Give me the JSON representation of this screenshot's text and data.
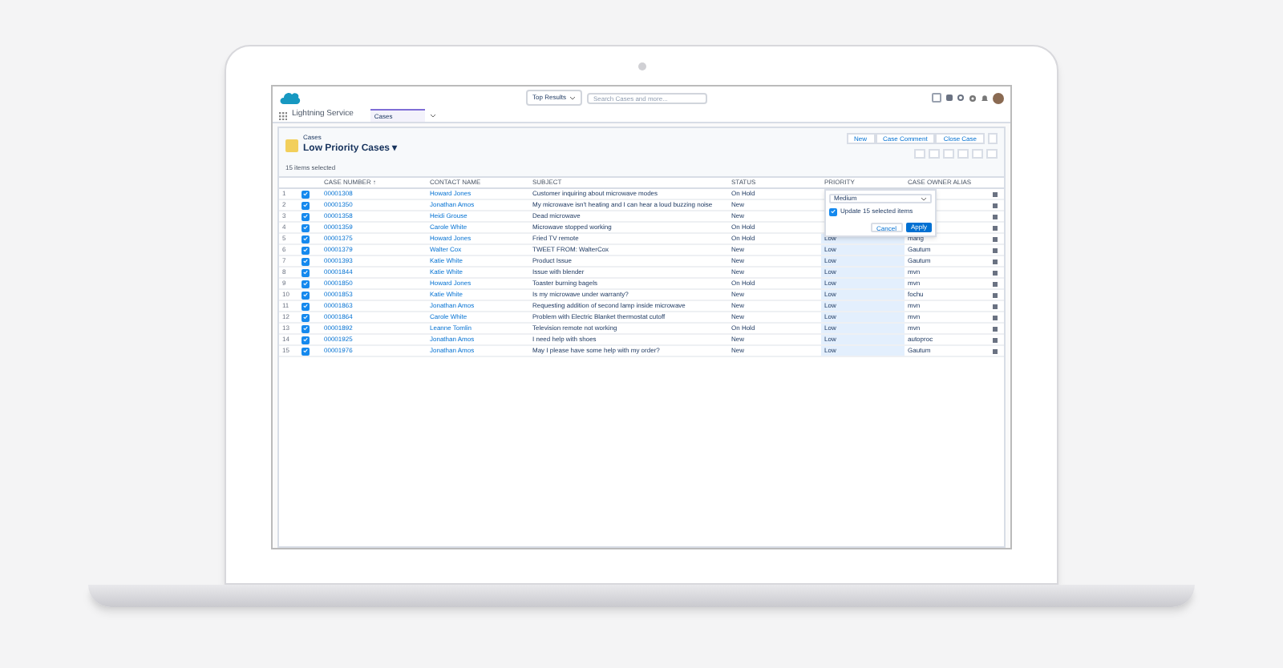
{
  "header": {
    "scope": "Top Results",
    "search": {
      "placeholder": "Search Cases and more..."
    }
  },
  "nav": {
    "app_name": "Lightning Service",
    "tabs": [
      {
        "label": "Cases",
        "selected": true
      }
    ]
  },
  "list": {
    "object": "Cases",
    "title": "Low Priority Cases",
    "caret": "▾",
    "count": "15 items selected",
    "buttons": [
      "New",
      "Case Comment",
      "Close Case"
    ]
  },
  "table": {
    "columns": [
      "CASE NUMBER ↑",
      "CONTACT NAME",
      "SUBJECT",
      "STATUS",
      "PRIORITY",
      "CASE OWNER ALIAS"
    ],
    "rows": [
      {
        "n": "1",
        "selected": true,
        "case": "00001308",
        "contact": "Howard Jones",
        "subject": "Customer inquiring about microwave modes",
        "status": "On Hold"
      },
      {
        "n": "2",
        "selected": true,
        "case": "00001350",
        "contact": "Jonathan Amos",
        "subject": "My microwave isn't heating and I can hear a loud buzzing noise",
        "status": "New"
      },
      {
        "n": "3",
        "selected": true,
        "case": "00001358",
        "contact": "Heidi Grouse",
        "subject": "Dead microwave",
        "status": "New"
      },
      {
        "n": "4",
        "selected": true,
        "case": "00001359",
        "contact": "Carole White",
        "subject": "Microwave stopped working",
        "status": "On Hold"
      },
      {
        "n": "5",
        "selected": true,
        "case": "00001375",
        "contact": "Howard Jones",
        "subject": "Fried TV remote",
        "status": "On Hold",
        "priority": "Low",
        "owner": "mang"
      },
      {
        "n": "6",
        "selected": true,
        "case": "00001379",
        "contact": "Walter Cox",
        "subject": "TWEET FROM: WalterCox",
        "status": "New",
        "priority": "Low",
        "owner": "Gautum"
      },
      {
        "n": "7",
        "selected": true,
        "case": "00001393",
        "contact": "Katie White",
        "subject": "Product Issue",
        "status": "New",
        "priority": "Low",
        "owner": "Gautum"
      },
      {
        "n": "8",
        "selected": true,
        "case": "00001844",
        "contact": "Katie White",
        "subject": "Issue with blender",
        "status": "New",
        "priority": "Low",
        "owner": "mvn"
      },
      {
        "n": "9",
        "selected": true,
        "case": "00001850",
        "contact": "Howard Jones",
        "subject": "Toaster burning bagels",
        "status": "On Hold",
        "priority": "Low",
        "owner": "mvn"
      },
      {
        "n": "10",
        "selected": true,
        "case": "00001853",
        "contact": "Katie White",
        "subject": "Is my microwave under warranty?",
        "status": "New",
        "priority": "Low",
        "owner": "fochu"
      },
      {
        "n": "11",
        "selected": true,
        "case": "00001863",
        "contact": "Jonathan Amos",
        "subject": "Requesting addition of second lamp inside microwave",
        "status": "New",
        "priority": "Low",
        "owner": "mvn"
      },
      {
        "n": "12",
        "selected": true,
        "case": "00001864",
        "contact": "Carole White",
        "subject": "Problem with Electric Blanket thermostat cutoff",
        "status": "New",
        "priority": "Low",
        "owner": "mvn"
      },
      {
        "n": "13",
        "selected": true,
        "case": "00001892",
        "contact": "Leanne Tomlin",
        "subject": "Television remote not working",
        "status": "On Hold",
        "priority": "Low",
        "owner": "mvn"
      },
      {
        "n": "14",
        "selected": true,
        "case": "00001925",
        "contact": "Jonathan Amos",
        "subject": "I need help with shoes",
        "status": "New",
        "priority": "Low",
        "owner": "autoproc"
      },
      {
        "n": "15",
        "selected": true,
        "case": "00001976",
        "contact": "Jonathan Amos",
        "subject": "May I please have some help with my order?",
        "status": "New",
        "priority": "Low",
        "owner": "Gautum"
      }
    ]
  },
  "editor": {
    "value": "Medium",
    "apply_all": {
      "label": "Update 15 selected items",
      "checked": true
    },
    "cancel": "Cancel",
    "apply": "Apply"
  }
}
